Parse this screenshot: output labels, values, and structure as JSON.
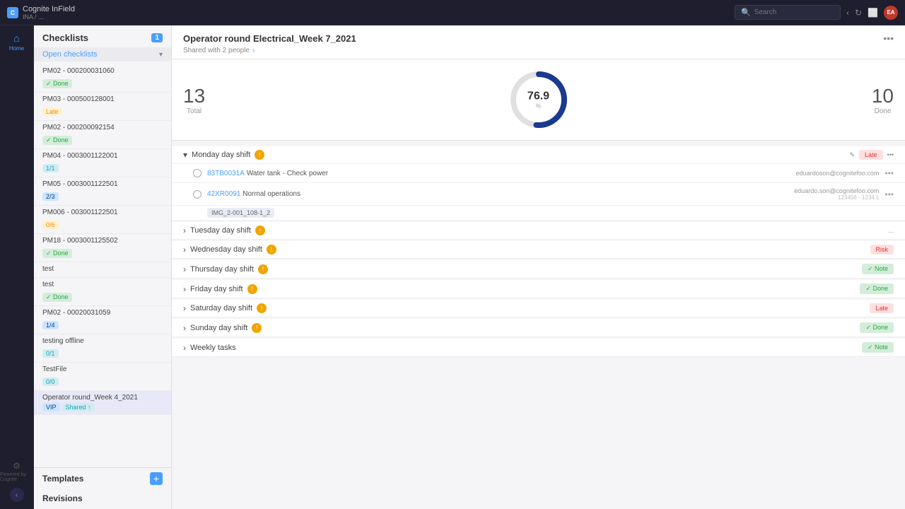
{
  "app": {
    "name": "Cognite InField",
    "subtitle": "INA / ...",
    "logo_char": "C"
  },
  "topbar": {
    "search_placeholder": "Search",
    "user_initials": "EA"
  },
  "nav": {
    "home_label": "Home"
  },
  "sidebar": {
    "title": "Checklists",
    "badge": "1",
    "open_section_label": "Open checklists",
    "items": [
      {
        "name": "PM02 - 000200031060",
        "tag": "Done",
        "tag_type": "done"
      },
      {
        "name": "PM03 - 000500128001",
        "tag": "Late",
        "tag_type": "late"
      },
      {
        "name": "PM02 - 000200092154",
        "tag": "Done",
        "tag_type": "done"
      },
      {
        "name": "PM04 - 0003001122001",
        "tag": "1/1",
        "tag_type": "ok"
      },
      {
        "name": "PM05 - 0003001122501",
        "tag": "2/3",
        "tag_type": "inprogress"
      },
      {
        "name": "PM006 - 003001122501",
        "tag": "0/6",
        "tag_type": "late"
      },
      {
        "name": "PM18 - 0003001125502",
        "tag": "Done",
        "tag_type": "done"
      },
      {
        "name": "test",
        "tag": "",
        "tag_type": ""
      },
      {
        "name": "test",
        "tag": "Done",
        "tag_type": "done"
      },
      {
        "name": "PM02 - 00020031059",
        "tag": "1/4",
        "tag_type": "inprogress"
      },
      {
        "name": "testing offline",
        "tag": "0/1",
        "tag_type": "ok"
      },
      {
        "name": "TestFile",
        "tag": "0/0",
        "tag_type": "ok"
      },
      {
        "name": "Operator round_Week 4_2021",
        "tag": "VIP",
        "tag_type": "inprogress"
      }
    ],
    "templates_label": "Templates",
    "templates_add": "+",
    "revisions_label": "Revisions"
  },
  "powered_by": "Powered by Cognite",
  "main": {
    "title": "Operator round Electrical_Week 7_2021",
    "shared_text": "Shared with 2 people",
    "stats": {
      "total_number": "13",
      "total_label": "Total",
      "percent_number": "76.9",
      "percent_label": "%",
      "done_number": "10",
      "done_label": "Done"
    },
    "shifts": [
      {
        "name": "Monday day shift",
        "expanded": true,
        "action_label": "Late",
        "action_type": "late",
        "tasks": [
          {
            "id": "83TB0031A",
            "desc": "Water tank - Check power",
            "assignee": "eduardoson@cognitefoo.com"
          },
          {
            "id": "42XR0091",
            "desc": "Normal operations",
            "assignee": "eduardo.son@cognitefoo.com",
            "sub_chip": "IMG_2-001_108-1_2"
          }
        ]
      },
      {
        "name": "Tuesday day shift",
        "expanded": false,
        "action_label": "",
        "action_type": ""
      },
      {
        "name": "Wednesday day shift",
        "expanded": false,
        "action_label": "Risk",
        "action_type": "late"
      },
      {
        "name": "Thursday day shift",
        "expanded": false,
        "action_label": "Note",
        "action_type": "done"
      },
      {
        "name": "Friday day shift",
        "expanded": false,
        "action_label": "Done",
        "action_type": "done"
      },
      {
        "name": "Saturday day shift",
        "expanded": false,
        "action_label": "Late",
        "action_type": "late"
      },
      {
        "name": "Sunday day shift",
        "expanded": false,
        "action_label": "Done",
        "action_type": "done"
      },
      {
        "name": "Weekly tasks",
        "expanded": false,
        "action_label": "Note",
        "action_type": "done"
      }
    ]
  },
  "colors": {
    "accent": "#4a9eff",
    "warning": "#f0a500",
    "success": "#28a745",
    "danger": "#e03030"
  }
}
